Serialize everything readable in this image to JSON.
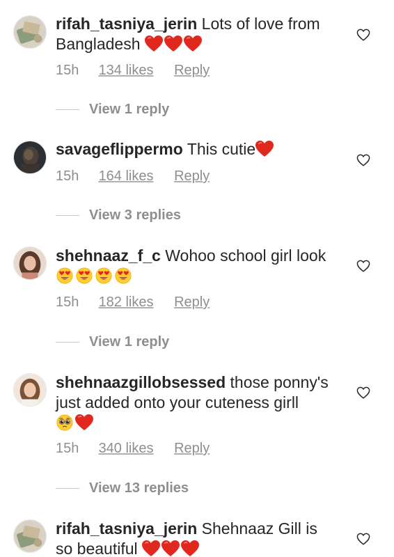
{
  "colors": {
    "text": "#262626",
    "muted": "#8e8e8e",
    "heart": "#e0281f"
  },
  "comments": [
    {
      "username": "rifah_tasniya_jerin",
      "text": "Lots of love from Bangladesh",
      "emoji": "red-heart x3",
      "time": "15h",
      "likes": "134 likes",
      "reply": "Reply",
      "view_replies": "View 1 reply"
    },
    {
      "username": "savageflippermo",
      "text": "This cutie",
      "emoji": "red-heart x1",
      "time": "15h",
      "likes": "164 likes",
      "reply": "Reply",
      "view_replies": "View 3 replies"
    },
    {
      "username": "shehnaaz_f_c",
      "text": "Wohoo school girl look",
      "emoji": "heart-eyes x4",
      "time": "15h",
      "likes": "182 likes",
      "reply": "Reply",
      "view_replies": "View 1 reply"
    },
    {
      "username": "shehnaazgillobsessed",
      "text": "those ponny's just added onto your cuteness girll",
      "emoji": "pleading-face, red-heart",
      "time": "15h",
      "likes": "340 likes",
      "reply": "Reply",
      "view_replies": "View 13 replies"
    },
    {
      "username": "rifah_tasniya_jerin",
      "text": "Shehnaaz Gill is so beautiful",
      "emoji": "red-heart x3"
    }
  ]
}
